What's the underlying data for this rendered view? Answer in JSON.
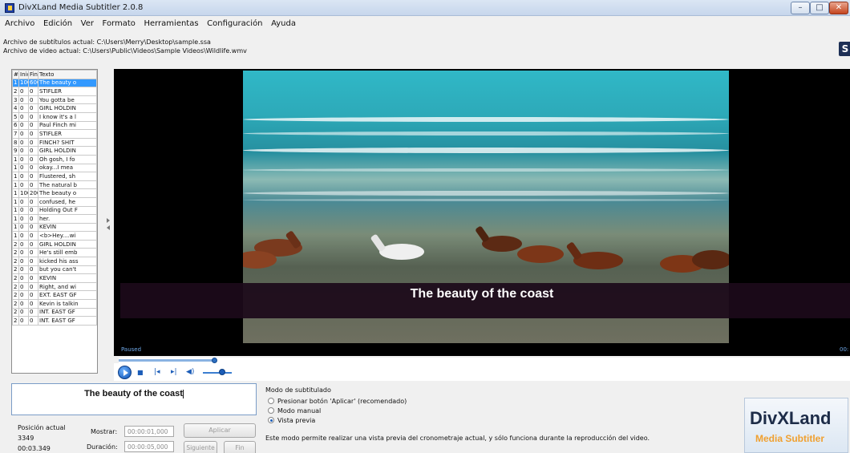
{
  "window": {
    "title": "DivXLand Media Subtitler 2.0.8"
  },
  "menu": [
    "Archivo",
    "Edición",
    "Ver",
    "Formato",
    "Herramientas",
    "Configuración",
    "Ayuda"
  ],
  "files": {
    "subtitle_line": "Archivo de subtítulos actual: C:\\Users\\Merry\\Desktop\\sample.ssa",
    "video_line": "Archivo de video actual:  C:\\Users\\Public\\Videos\\Sample Videos\\Wildlife.wmv"
  },
  "subtitle_list": {
    "columns": [
      "#",
      "Inic",
      "Fin",
      "Texto"
    ],
    "rows": [
      [
        "1",
        "100",
        "600",
        "The beauty o"
      ],
      [
        "2",
        "0",
        "0",
        "STIFLER"
      ],
      [
        "3",
        "0",
        "0",
        "You gotta be"
      ],
      [
        "4",
        "0",
        "0",
        "GIRL HOLDIN"
      ],
      [
        "5",
        "0",
        "0",
        "I know it's a l"
      ],
      [
        "6",
        "0",
        "0",
        "Paul Finch mi"
      ],
      [
        "7",
        "0",
        "0",
        "STIFLER"
      ],
      [
        "8",
        "0",
        "0",
        "FINCH? SHIT"
      ],
      [
        "9",
        "0",
        "0",
        "GIRL HOLDIN"
      ],
      [
        "1",
        "0",
        "0",
        "Oh gosh, I fo"
      ],
      [
        "1",
        "0",
        "0",
        "okay...I mea"
      ],
      [
        "1",
        "0",
        "0",
        "Flustered, sh"
      ],
      [
        "1",
        "0",
        "0",
        "The natural b"
      ],
      [
        "1",
        "100",
        "200",
        "The beauty o"
      ],
      [
        "1",
        "0",
        "0",
        "confused, he"
      ],
      [
        "1",
        "0",
        "0",
        "Holding Out F"
      ],
      [
        "1",
        "0",
        "0",
        "her."
      ],
      [
        "1",
        "0",
        "0",
        "KEVIN"
      ],
      [
        "1",
        "0",
        "0",
        "<b>Hey....wi"
      ],
      [
        "2",
        "0",
        "0",
        "GIRL HOLDIN"
      ],
      [
        "2",
        "0",
        "0",
        "He's still emb"
      ],
      [
        "2",
        "0",
        "0",
        "kicked his ass"
      ],
      [
        "2",
        "0",
        "0",
        "but you can't"
      ],
      [
        "2",
        "0",
        "0",
        "KEVIN"
      ],
      [
        "2",
        "0",
        "0",
        "Right, and wi"
      ],
      [
        "2",
        "0",
        "0",
        "EXT. EAST GF"
      ],
      [
        "2",
        "0",
        "0",
        "Kevin is talkin"
      ],
      [
        "2",
        "0",
        "0",
        "INT. EAST GF"
      ],
      [
        "2",
        "0",
        "0",
        "INT. EAST GF"
      ]
    ]
  },
  "player": {
    "subtitle": "The beauty of the coast",
    "status": "Paused",
    "time_partial": "00:",
    "seek_progress": 0.13,
    "volume_level": 0.55
  },
  "editor": {
    "text": "The beauty of the coast",
    "position_label": "Posición actual",
    "position_value": "3349",
    "position_time": "00:03.349",
    "show_label": "Mostrar:",
    "show_value": "00:00:01,000",
    "duration_label": "Duración:",
    "duration_value": "00:00:05,000",
    "apply_label": "Aplicar",
    "next_label": "Siguiente",
    "end_label": "Fin"
  },
  "mode": {
    "title": "Modo de subtitulado",
    "options": [
      "Presionar botón 'Aplicar' (recomendado)",
      "Modo manual",
      "Vista previa"
    ],
    "selected": 2,
    "description": "Este modo permite realizar una vista previa del cronometraje actual, y sólo funciona durante la reproducción del video."
  },
  "logo": {
    "main": "DivXLand",
    "sub": "Media Subtitler"
  },
  "colors": {
    "selection": "#3399ff",
    "player_accent": "#1c5db8",
    "logo_sub": "#f0a030"
  },
  "icons": {
    "app": "app-icon",
    "play": "play-icon",
    "stop": "stop-icon",
    "prev": "previous-frame-icon",
    "next": "next-frame-icon",
    "volume": "volume-icon"
  }
}
